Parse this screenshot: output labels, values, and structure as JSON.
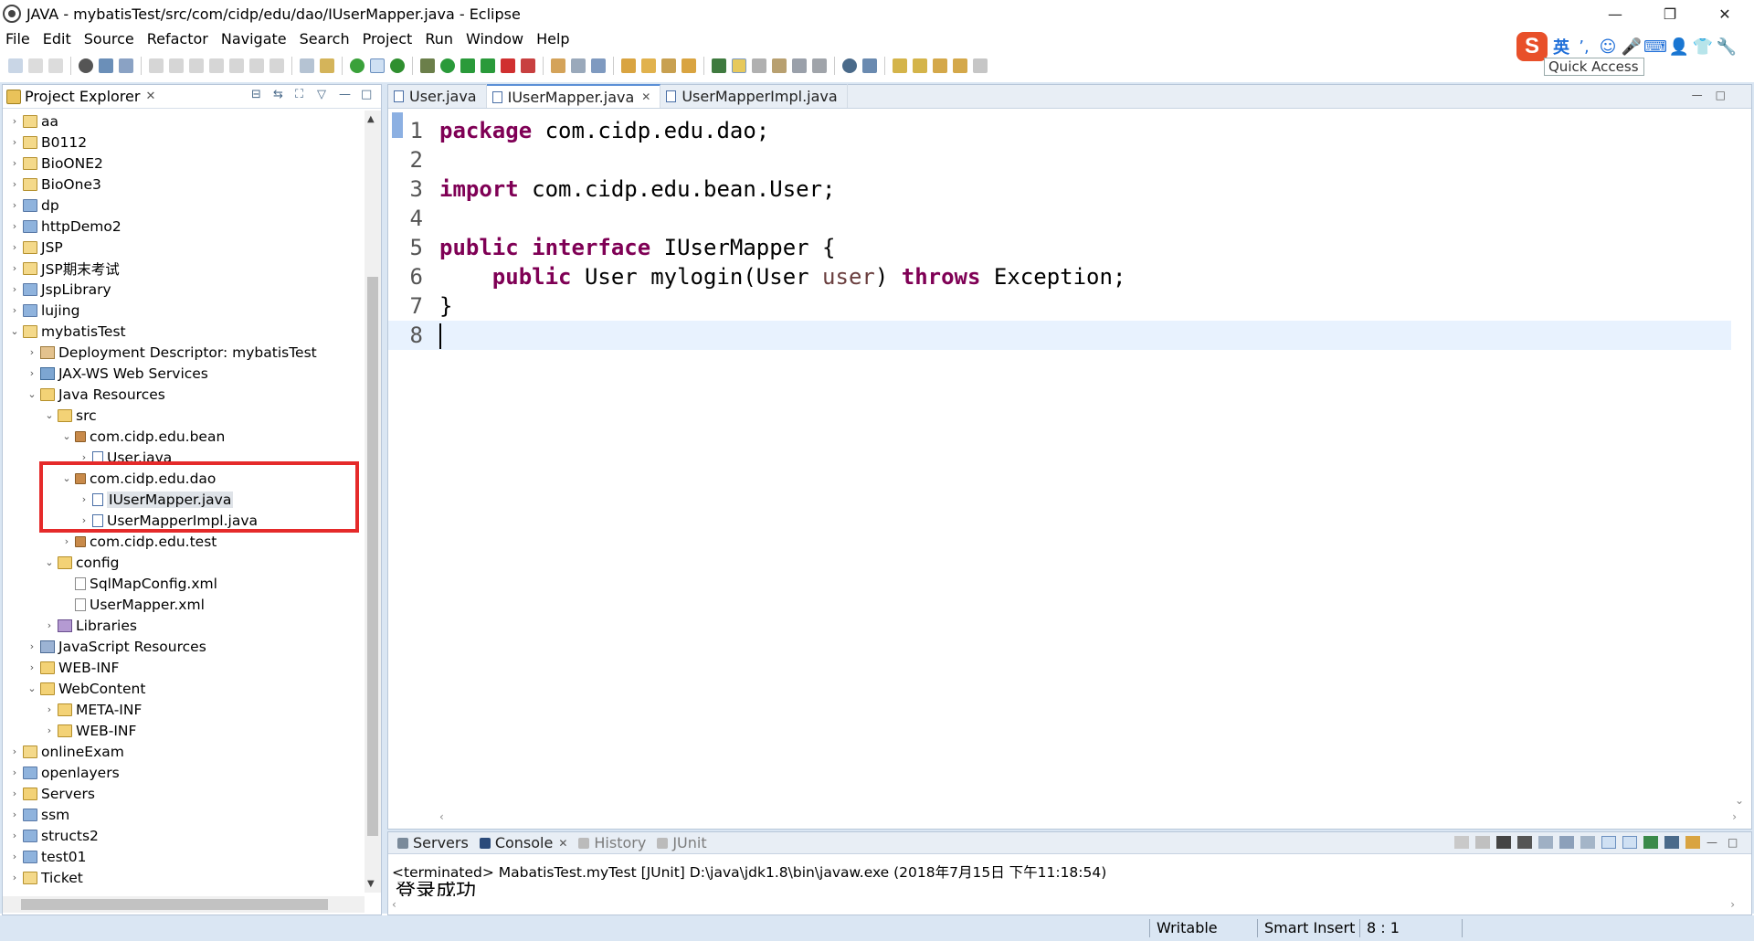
{
  "window": {
    "title": "JAVA - mybatisTest/src/com/cidp/edu/dao/IUserMapper.java - Eclipse",
    "controls": {
      "minimize": "—",
      "restore": "❐",
      "close": "✕"
    }
  },
  "menubar": [
    "File",
    "Edit",
    "Source",
    "Refactor",
    "Navigate",
    "Search",
    "Project",
    "Run",
    "Window",
    "Help"
  ],
  "toolbar": {
    "quick_access": "Quick Access"
  },
  "ime": {
    "logo": "S",
    "mode": "英",
    "punct": "’,",
    "emoji": "☺",
    "mic": "🎤",
    "keyboard": "⌨",
    "user": "👤",
    "shirt": "👕",
    "tools": "🔧"
  },
  "explorer": {
    "title": "Project Explorer",
    "close": "✕",
    "tree": [
      {
        "label": "aa",
        "depth": 0,
        "arrow": "›",
        "icon": "project"
      },
      {
        "label": "B0112",
        "depth": 0,
        "arrow": "›",
        "icon": "project"
      },
      {
        "label": "BioONE2",
        "depth": 0,
        "arrow": "›",
        "icon": "project"
      },
      {
        "label": "BioOne3",
        "depth": 0,
        "arrow": "›",
        "icon": "project"
      },
      {
        "label": "dp",
        "depth": 0,
        "arrow": "›",
        "icon": "folder"
      },
      {
        "label": "httpDemo2",
        "depth": 0,
        "arrow": "›",
        "icon": "folder"
      },
      {
        "label": "JSP",
        "depth": 0,
        "arrow": "›",
        "icon": "project"
      },
      {
        "label": "JSP期末考试",
        "depth": 0,
        "arrow": "›",
        "icon": "project"
      },
      {
        "label": "JspLibrary",
        "depth": 0,
        "arrow": "›",
        "icon": "folder"
      },
      {
        "label": "lujing",
        "depth": 0,
        "arrow": "›",
        "icon": "folder"
      },
      {
        "label": "mybatisTest",
        "depth": 0,
        "arrow": "⌄",
        "icon": "project"
      },
      {
        "label": "Deployment Descriptor: mybatisTest",
        "depth": 1,
        "arrow": "›",
        "icon": "dd"
      },
      {
        "label": "JAX-WS Web Services",
        "depth": 1,
        "arrow": "›",
        "icon": "web"
      },
      {
        "label": "Java Resources",
        "depth": 1,
        "arrow": "⌄",
        "icon": "folder-open"
      },
      {
        "label": "src",
        "depth": 2,
        "arrow": "⌄",
        "icon": "folder-open"
      },
      {
        "label": "com.cidp.edu.bean",
        "depth": 3,
        "arrow": "⌄",
        "icon": "package"
      },
      {
        "label": "User.java",
        "depth": 4,
        "arrow": "›",
        "icon": "java"
      },
      {
        "label": "com.cidp.edu.dao",
        "depth": 3,
        "arrow": "⌄",
        "icon": "package"
      },
      {
        "label": "IUserMapper.java",
        "depth": 4,
        "arrow": "›",
        "icon": "java",
        "selected": true
      },
      {
        "label": "UserMapperImpl.java",
        "depth": 4,
        "arrow": "›",
        "icon": "java"
      },
      {
        "label": "com.cidp.edu.test",
        "depth": 3,
        "arrow": "›",
        "icon": "package"
      },
      {
        "label": "config",
        "depth": 2,
        "arrow": "⌄",
        "icon": "folder-open"
      },
      {
        "label": "SqlMapConfig.xml",
        "depth": 3,
        "arrow": "",
        "icon": "xml"
      },
      {
        "label": "UserMapper.xml",
        "depth": 3,
        "arrow": "",
        "icon": "xml"
      },
      {
        "label": "Libraries",
        "depth": 2,
        "arrow": "›",
        "icon": "lib"
      },
      {
        "label": "JavaScript Resources",
        "depth": 1,
        "arrow": "›",
        "icon": "js"
      },
      {
        "label": "WEB-INF",
        "depth": 1,
        "arrow": "›",
        "icon": "folder-open"
      },
      {
        "label": "WebContent",
        "depth": 1,
        "arrow": "⌄",
        "icon": "folder-open"
      },
      {
        "label": "META-INF",
        "depth": 2,
        "arrow": "›",
        "icon": "folder-open"
      },
      {
        "label": "WEB-INF",
        "depth": 2,
        "arrow": "›",
        "icon": "folder-open"
      },
      {
        "label": "onlineExam",
        "depth": 0,
        "arrow": "›",
        "icon": "project"
      },
      {
        "label": "openlayers",
        "depth": 0,
        "arrow": "›",
        "icon": "folder"
      },
      {
        "label": "Servers",
        "depth": 0,
        "arrow": "›",
        "icon": "folder-open"
      },
      {
        "label": "ssm",
        "depth": 0,
        "arrow": "›",
        "icon": "folder"
      },
      {
        "label": "structs2",
        "depth": 0,
        "arrow": "›",
        "icon": "folder"
      },
      {
        "label": "test01",
        "depth": 0,
        "arrow": "›",
        "icon": "folder"
      },
      {
        "label": "Ticket",
        "depth": 0,
        "arrow": "›",
        "icon": "project"
      }
    ]
  },
  "editor": {
    "tabs": [
      {
        "label": "User.java",
        "active": false
      },
      {
        "label": "IUserMapper.java",
        "active": true
      },
      {
        "label": "UserMapperImpl.java",
        "active": false
      }
    ],
    "lines": [
      {
        "n": "1",
        "parts": [
          [
            "kw",
            "package"
          ],
          [
            "",
            " com.cidp.edu.dao;"
          ]
        ]
      },
      {
        "n": "2",
        "parts": []
      },
      {
        "n": "3",
        "parts": [
          [
            "kw",
            "import"
          ],
          [
            "",
            " com.cidp.edu.bean.User;"
          ]
        ]
      },
      {
        "n": "4",
        "parts": []
      },
      {
        "n": "5",
        "parts": [
          [
            "kw",
            "public"
          ],
          [
            "",
            " "
          ],
          [
            "kw",
            "interface"
          ],
          [
            "",
            " IUserMapper {"
          ]
        ]
      },
      {
        "n": "6",
        "parts": [
          [
            "",
            "    "
          ],
          [
            "kw",
            "public"
          ],
          [
            "",
            " User mylogin(User "
          ],
          [
            "param",
            "user"
          ],
          [
            "",
            ") "
          ],
          [
            "kw",
            "throws"
          ],
          [
            "",
            " Exception;"
          ]
        ]
      },
      {
        "n": "7",
        "parts": [
          [
            "",
            "}"
          ]
        ]
      },
      {
        "n": "8",
        "parts": [],
        "current": true
      }
    ]
  },
  "console": {
    "tabs": [
      {
        "label": "Servers",
        "inactive": false,
        "color": "#7a8a9a",
        "close": false
      },
      {
        "label": "Console",
        "inactive": false,
        "color": "#2a4a7a",
        "close": true
      },
      {
        "label": "History",
        "inactive": true,
        "color": "#bbbbbb",
        "close": false
      },
      {
        "label": "JUnit",
        "inactive": true,
        "color": "#bbbbbb",
        "close": false
      }
    ],
    "close": "✕",
    "terminated": "<terminated> MabatisTest.myTest [JUnit] D:\\java\\jdk1.8\\bin\\javaw.exe (2018年7月15日 下午11:18:54)",
    "output": "登录成功"
  },
  "status": {
    "writable": "Writable",
    "insert_mode": "Smart Insert",
    "position": "8 : 1"
  },
  "colors": {
    "keyword": "#7f0055",
    "highlight_box": "#e52a2a",
    "current_line": "#e8f2fe"
  }
}
